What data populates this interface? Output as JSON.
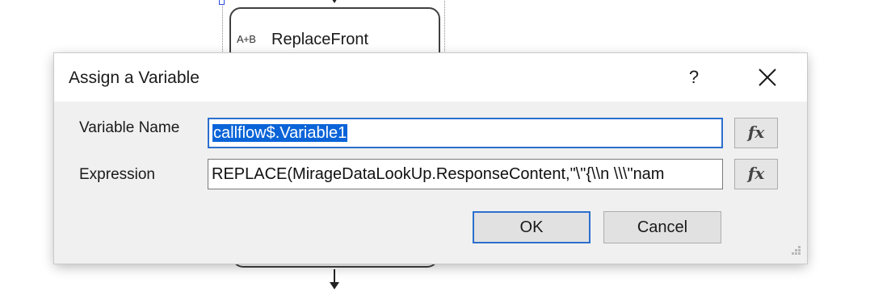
{
  "canvas": {
    "node": {
      "icon_label": "A+B",
      "label": "ReplaceFront"
    }
  },
  "dialog": {
    "title": "Assign a Variable",
    "help_glyph": "?",
    "fields": {
      "variable_name": {
        "label": "Variable Name",
        "value": "callflow$.Variable1"
      },
      "expression": {
        "label": "Expression",
        "value": "REPLACE(MirageDataLookUp.ResponseContent,\"\\\"{\\\\n  \\\\\\\"nam"
      }
    },
    "fx_label": "fx",
    "buttons": {
      "ok": "OK",
      "cancel": "Cancel"
    }
  },
  "colors": {
    "accent": "#2b6fce",
    "selection": "#0a64d8",
    "dialog_bg": "#f0f0f0"
  }
}
